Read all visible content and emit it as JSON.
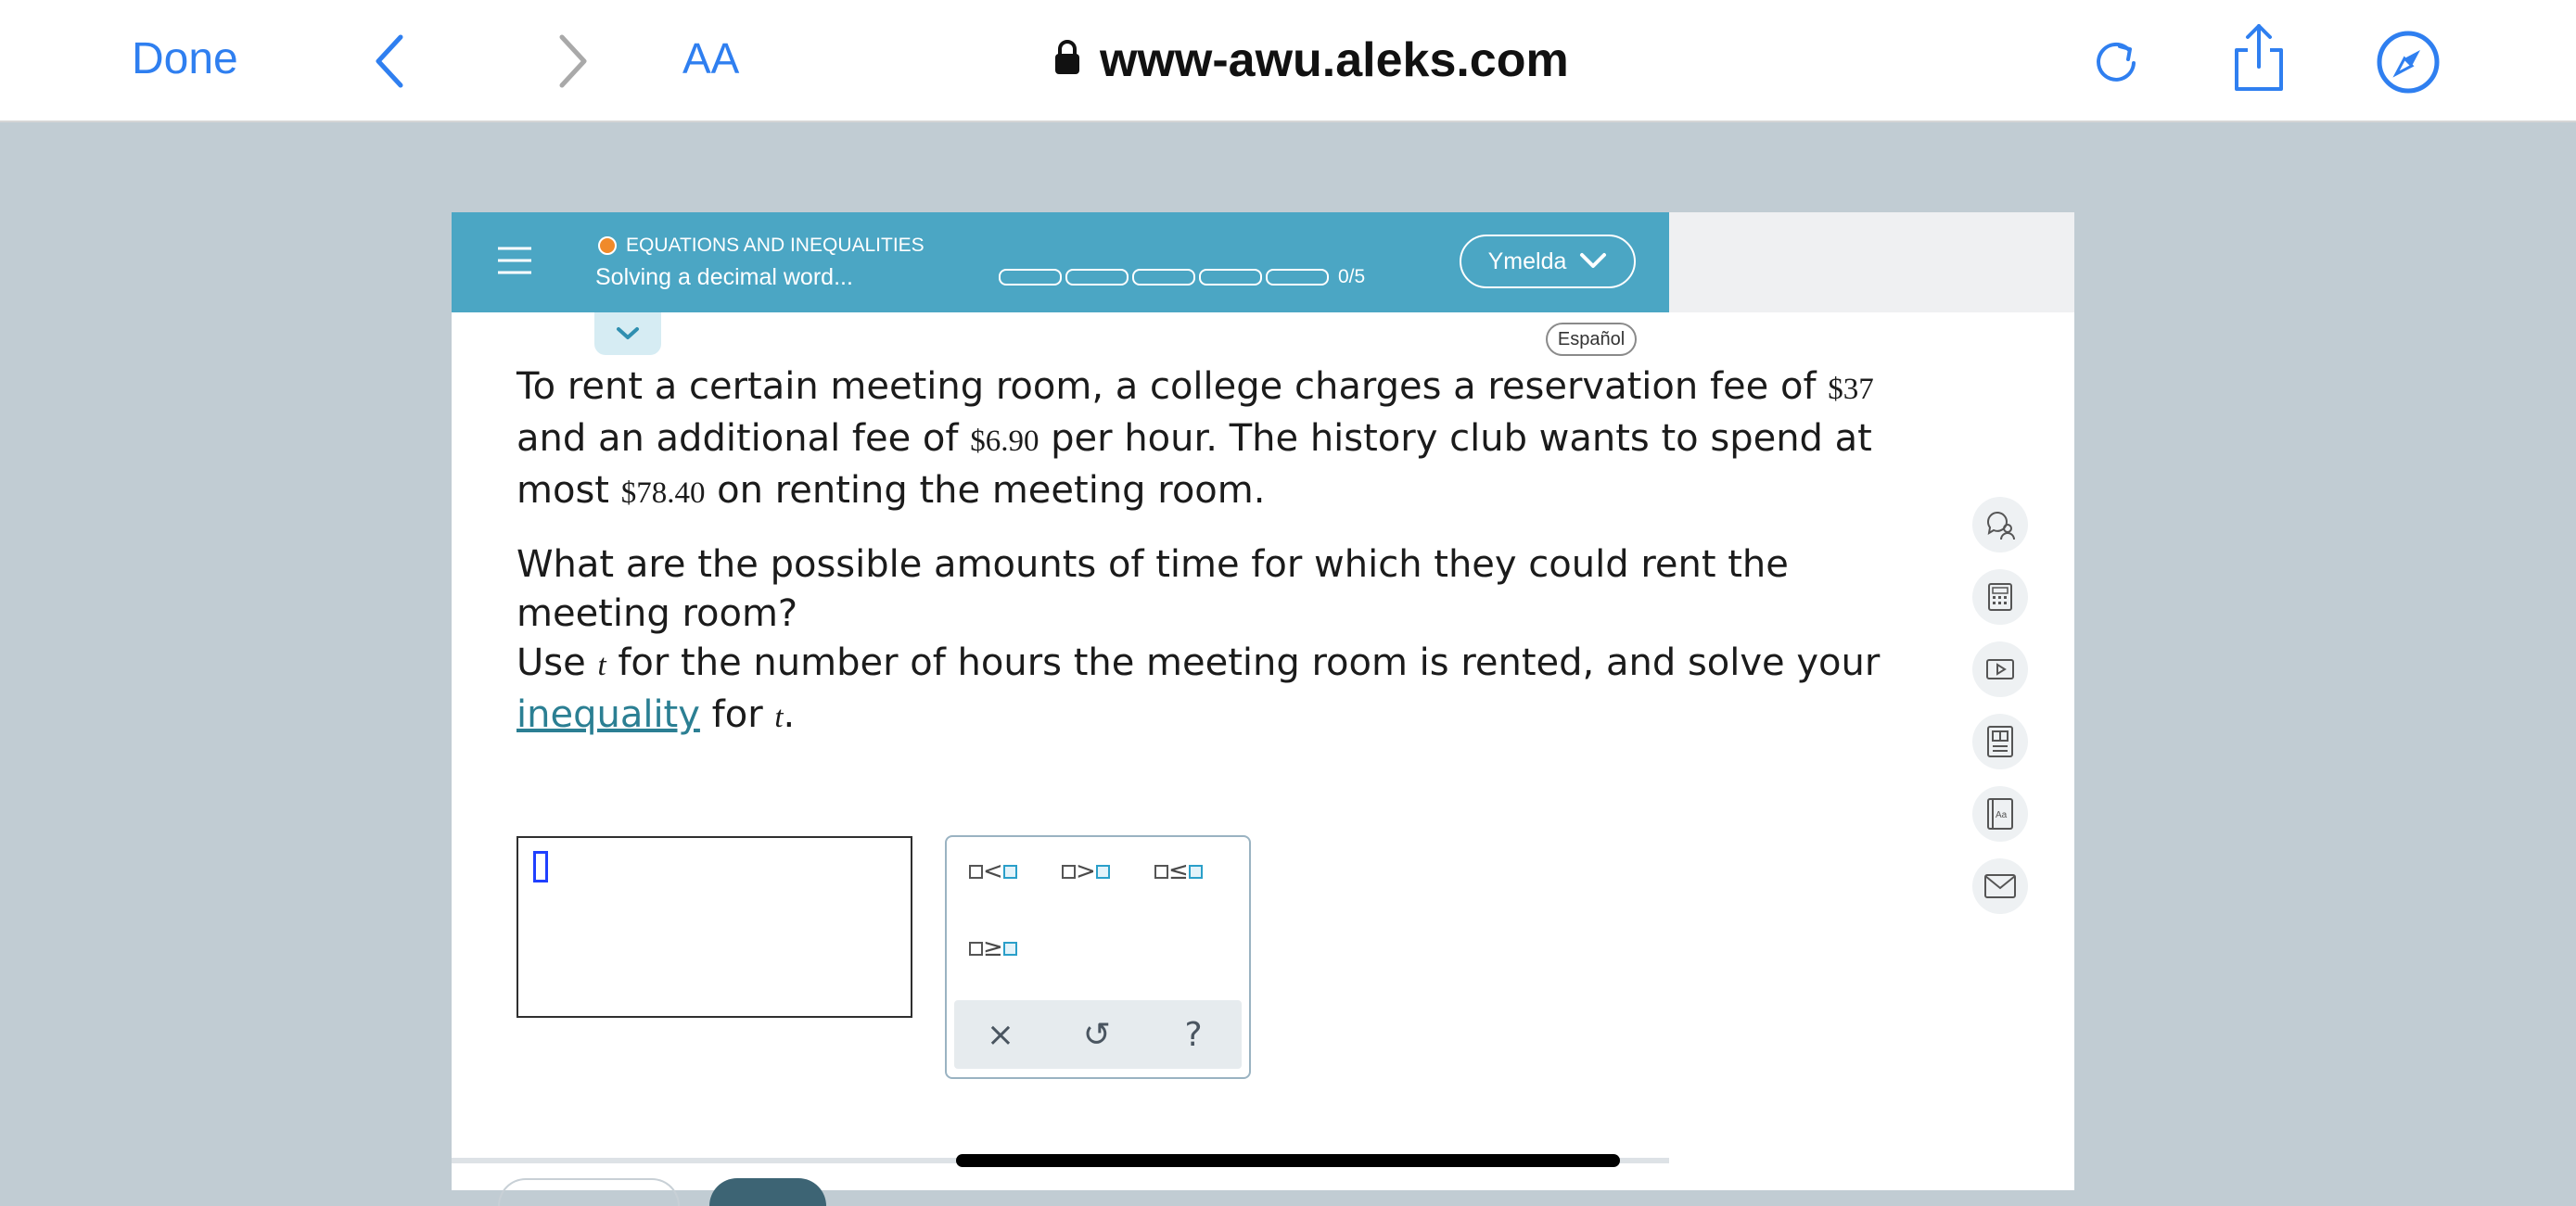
{
  "browser": {
    "done_label": "Done",
    "text_size_label": "AA",
    "url": "www-awu.aleks.com",
    "accent_color": "#2f7ff0"
  },
  "header": {
    "topic": "EQUATIONS AND INEQUALITIES",
    "subtopic": "Solving a decimal word...",
    "progress_text": "0/5",
    "progress_segments": 5,
    "progress_completed": 0,
    "user_name": "Ymelda",
    "header_color": "#4ba6c4"
  },
  "language_button": "Español",
  "question": {
    "p1": {
      "t1": "To rent a certain meeting room, a college charges a reservation fee of ",
      "fee1": "$37",
      "t2": " and an additional fee of ",
      "fee2": "$6.90",
      "t3": " per hour. The history club wants to spend at most ",
      "budget": "$78.40",
      "t4": " on renting the meeting room."
    },
    "p2": {
      "t1": "What are the possible amounts of time for which they could rent the meeting room?",
      "t2": "Use ",
      "var1": "t",
      "t3": " for the number of hours the meeting room is rented, and solve your ",
      "link": "inequality",
      "t4": " for ",
      "var2": "t",
      "t5": "."
    }
  },
  "answer": {
    "value": ""
  },
  "palette": {
    "lt": "<",
    "gt": ">",
    "le": "≤",
    "ge": "≥",
    "clear": "×",
    "undo": "↺",
    "help": "?"
  },
  "tools": [
    "tutor-icon",
    "calculator-icon",
    "video-icon",
    "answer-key-icon",
    "dictionary-icon",
    "mail-icon"
  ]
}
